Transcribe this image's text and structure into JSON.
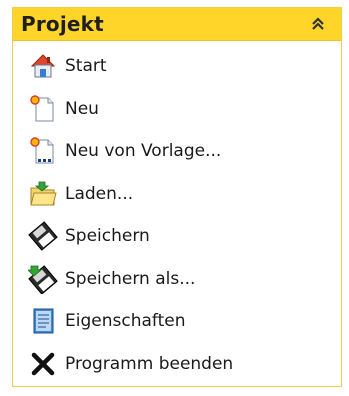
{
  "panel": {
    "title": "Projekt",
    "collapse_icon": "double-chevron-up-icon",
    "colors": {
      "header_bg": "#ffd52a",
      "border": "#f5cc4a",
      "text": "#1a1a1a"
    }
  },
  "items": [
    {
      "label": "Start",
      "icon": "home-icon"
    },
    {
      "label": "Neu",
      "icon": "new-document-icon"
    },
    {
      "label": "Neu von Vorlage...",
      "icon": "new-from-template-icon"
    },
    {
      "label": "Laden...",
      "icon": "open-folder-icon"
    },
    {
      "label": "Speichern",
      "icon": "save-disk-icon"
    },
    {
      "label": "Speichern als...",
      "icon": "save-as-icon"
    },
    {
      "label": "Eigenschaften",
      "icon": "properties-icon"
    },
    {
      "label": "Programm beenden",
      "icon": "exit-icon"
    }
  ]
}
